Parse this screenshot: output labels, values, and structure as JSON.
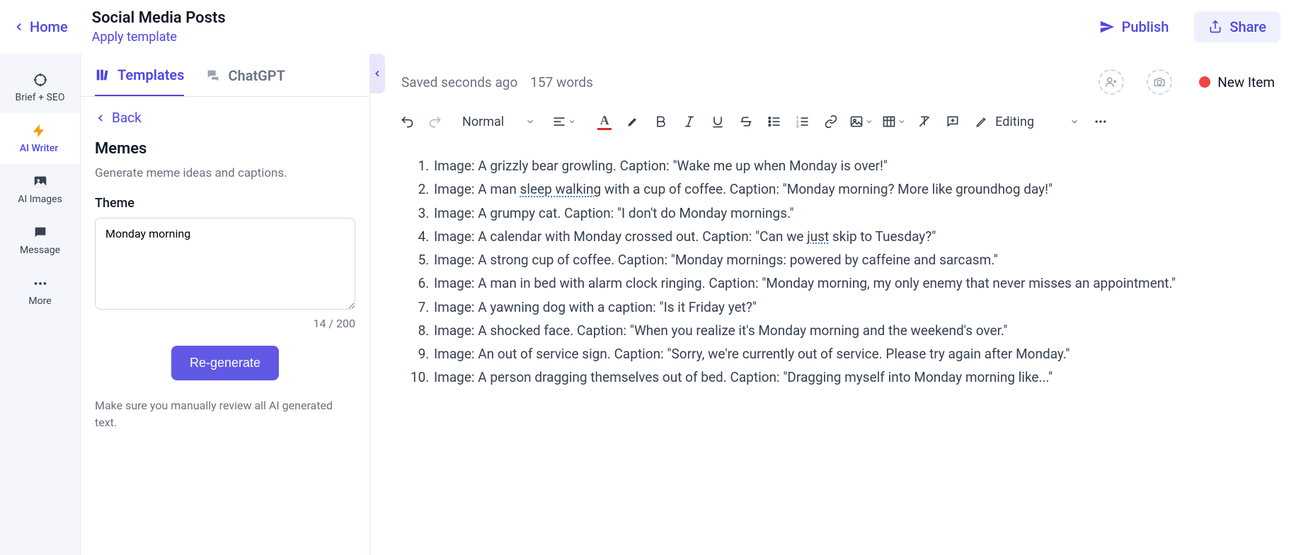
{
  "topbar": {
    "home": "Home",
    "title": "Social Media Posts",
    "apply_template": "Apply template",
    "publish": "Publish",
    "share": "Share"
  },
  "leftnav": {
    "brief": "Brief + SEO",
    "ai_writer": "AI Writer",
    "ai_images": "AI Images",
    "message": "Message",
    "more": "More"
  },
  "panel": {
    "tab_templates": "Templates",
    "tab_chatgpt": "ChatGPT",
    "back": "Back",
    "title": "Memes",
    "desc": "Generate meme ideas and captions.",
    "theme_label": "Theme",
    "theme_value": "Monday morning",
    "char_count": "14 / 200",
    "regenerate": "Re-generate",
    "review_note": "Make sure you manually review all AI generated text."
  },
  "editor": {
    "saved": "Saved seconds ago",
    "word_count": "157 words",
    "new_item": "New Item",
    "paragraph_style": "Normal",
    "editing_mode": "Editing"
  },
  "memes": [
    {
      "text_before": "Image: A grizzly bear growling. Caption: \"Wake me up when Monday is over!\"",
      "spell": "",
      "text_after": ""
    },
    {
      "text_before": "Image: A man ",
      "spell": "sleep walking",
      "text_after": " with a cup of coffee. Caption: \"Monday morning? More like groundhog day!\""
    },
    {
      "text_before": "Image: A grumpy cat. Caption: \"I don't do Monday mornings.\"",
      "spell": "",
      "text_after": ""
    },
    {
      "text_before": "Image: A calendar with Monday crossed out. Caption: \"Can we ",
      "spell": "just",
      "text_after": " skip to Tuesday?\""
    },
    {
      "text_before": "Image: A strong cup of coffee. Caption: \"Monday mornings: powered by caffeine and sarcasm.\"",
      "spell": "",
      "text_after": ""
    },
    {
      "text_before": "Image: A man in bed with alarm clock ringing. Caption: \"Monday morning, my only enemy that never misses an appointment.\"",
      "spell": "",
      "text_after": ""
    },
    {
      "text_before": "Image: A yawning dog with a caption: \"Is it Friday yet?\"",
      "spell": "",
      "text_after": ""
    },
    {
      "text_before": "Image: A shocked face. Caption: \"When you realize it's Monday morning and the weekend's over.\"",
      "spell": "",
      "text_after": ""
    },
    {
      "text_before": "Image: An out of service sign. Caption: \"Sorry, we're currently out of service. Please try again after Monday.\"",
      "spell": "",
      "text_after": ""
    },
    {
      "text_before": "Image: A person dragging themselves out of bed. Caption: \"Dragging myself into Monday morning like...\"",
      "spell": "",
      "text_after": ""
    }
  ]
}
